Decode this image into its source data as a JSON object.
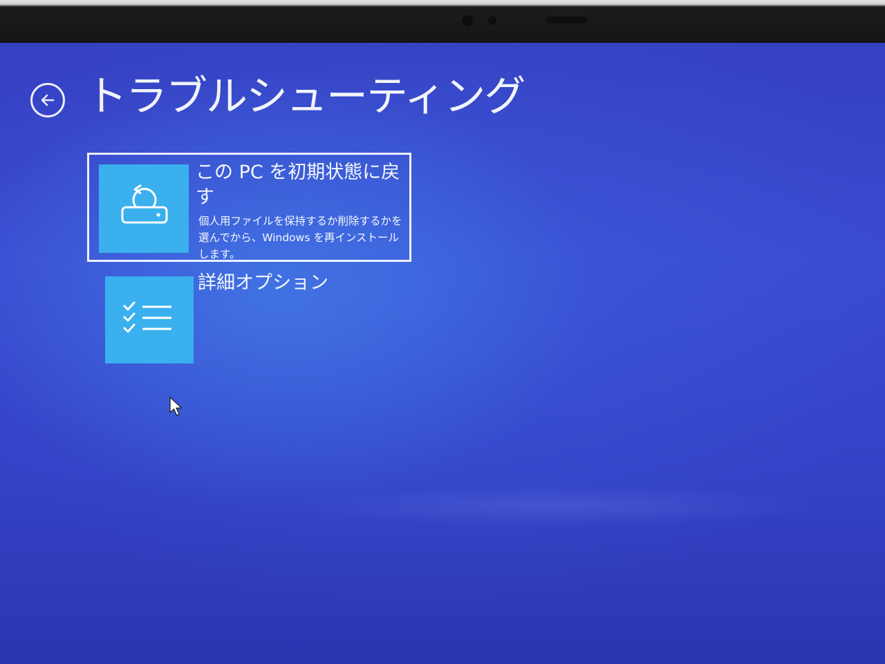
{
  "screen": {
    "title": "トラブルシューティング",
    "back_label": "戻る"
  },
  "options": [
    {
      "title": "この PC を初期状態に戻す",
      "description": "個人用ファイルを保持するか削除するかを選んでから、Windows を再インストールします。",
      "icon": "reset-pc-icon"
    },
    {
      "title": "詳細オプション",
      "icon": "checklist-icon"
    }
  ],
  "colors": {
    "background": "#3a4bd0",
    "tile": "#3ab0ee",
    "text": "#f4f7fc"
  }
}
